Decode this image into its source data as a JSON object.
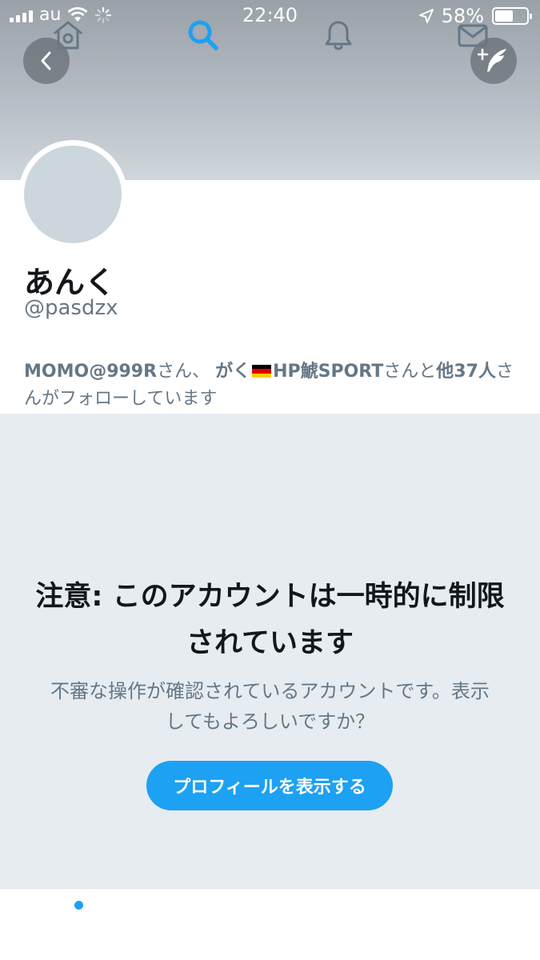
{
  "status_bar": {
    "carrier": "au",
    "time": "22:40",
    "battery_percent": "58%",
    "battery_level": 0.58,
    "signal_bars": 4
  },
  "header": {
    "back_icon": "chevron-left-icon",
    "compose_icon": "feather-plus-icon",
    "banner_color": "#aeb5bc"
  },
  "profile": {
    "display_name": "あんく",
    "handle": "@pasdzx",
    "followed_by": {
      "user1": "MOMO@999R",
      "suffix1": "さん、",
      "user2_prefix": "がく",
      "user2_suffix": "HP鯱SPORT",
      "suffix2": "さんと",
      "others": "他37人",
      "tail": "さんがフォローしています"
    }
  },
  "warning": {
    "title": "注意: このアカウントは一時的に制限されています",
    "message": "不審な操作が確認されているアカウントです。表示してもよろしいですか？",
    "button_label": "プロフィールを表示する"
  },
  "tabbar": {
    "items": [
      {
        "name": "home",
        "icon": "home-icon"
      },
      {
        "name": "search",
        "icon": "search-icon",
        "active": true
      },
      {
        "name": "notifications",
        "icon": "bell-icon"
      },
      {
        "name": "messages",
        "icon": "mail-icon"
      }
    ]
  },
  "colors": {
    "accent": "#1da1f2",
    "warning_bg": "#e6ecf0",
    "text_primary": "#14171a",
    "text_secondary": "#657786"
  }
}
